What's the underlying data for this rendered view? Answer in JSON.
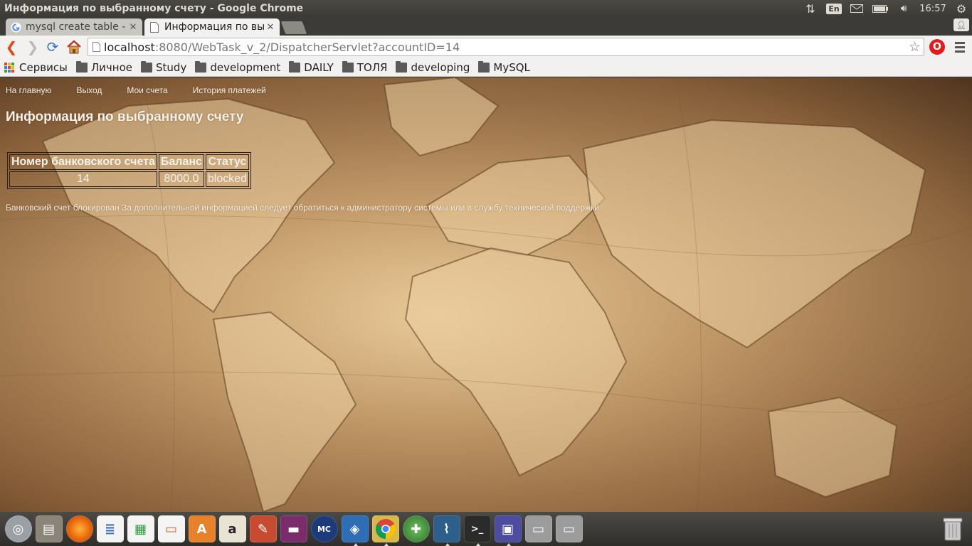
{
  "window": {
    "title": "Информация по выбранному счету - Google Chrome"
  },
  "system_tray": {
    "keyboard_layout": "En",
    "time": "16:57",
    "icons": [
      "network-updown-icon",
      "mail-icon",
      "battery-icon",
      "volume-icon",
      "gear-icon"
    ]
  },
  "tabs": [
    {
      "label": "mysql create table - ",
      "favicon": "google-icon",
      "active": false
    },
    {
      "label": "Информация по вы",
      "favicon": "page-icon",
      "active": true
    }
  ],
  "toolbar": {
    "url_host": "localhost",
    "url_rest": ":8080/WebTask_v_2/DispatcherServlet?accountID=14"
  },
  "bookmarks": [
    {
      "label": "Сервисы",
      "icon": "apps-grid-icon"
    },
    {
      "label": "Личное",
      "icon": "folder-icon"
    },
    {
      "label": "Study",
      "icon": "folder-icon"
    },
    {
      "label": "development",
      "icon": "folder-icon"
    },
    {
      "label": "DAILY",
      "icon": "folder-icon"
    },
    {
      "label": "ТОЛЯ",
      "icon": "folder-icon"
    },
    {
      "label": "developing",
      "icon": "folder-icon"
    },
    {
      "label": "MySQL",
      "icon": "folder-icon"
    }
  ],
  "page": {
    "nav": [
      "На главную",
      "Выход",
      "Мои счета",
      "История платежей"
    ],
    "title": "Информация по выбранному счету",
    "table": {
      "headers": [
        "Номер банковского счета",
        "Баланс",
        "Статус"
      ],
      "rows": [
        [
          "14",
          "8000.0",
          "blocked"
        ]
      ]
    },
    "notice": "Банковский счет блокирован За дополнительной информацией следует обратиться к администратору системы или в службу технической поддержки"
  },
  "dock": {
    "apps": [
      {
        "name": "dash-icon",
        "color": "#9aa0a6"
      },
      {
        "name": "files-icon",
        "color": "#8a8578"
      },
      {
        "name": "firefox-icon",
        "color": "#e66000"
      },
      {
        "name": "writer-icon",
        "color": "#3f6fb3"
      },
      {
        "name": "calc-icon",
        "color": "#2e9b3a"
      },
      {
        "name": "impress-icon",
        "color": "#d4612a"
      },
      {
        "name": "software-center-icon",
        "color": "#e8822a"
      },
      {
        "name": "amazon-icon",
        "color": "#e9e3d4"
      },
      {
        "name": "settings-icon",
        "color": "#c84b31"
      },
      {
        "name": "media-icon",
        "color": "#7b2c6b"
      },
      {
        "name": "mc-icon",
        "color": "#1d3a7a"
      },
      {
        "name": "virtualbox-icon",
        "color": "#2f6db5"
      },
      {
        "name": "chrome-icon",
        "color": "#e0c34a"
      },
      {
        "name": "globe-icon",
        "color": "#3f8a3f"
      },
      {
        "name": "mysql-workbench-icon",
        "color": "#2d5f8a"
      },
      {
        "name": "terminal-icon",
        "color": "#2b2b2b"
      },
      {
        "name": "screenshot-icon",
        "color": "#4d4da0"
      },
      {
        "name": "drive-icon",
        "color": "#9c9c9c"
      },
      {
        "name": "drive2-icon",
        "color": "#9c9c9c"
      }
    ]
  }
}
